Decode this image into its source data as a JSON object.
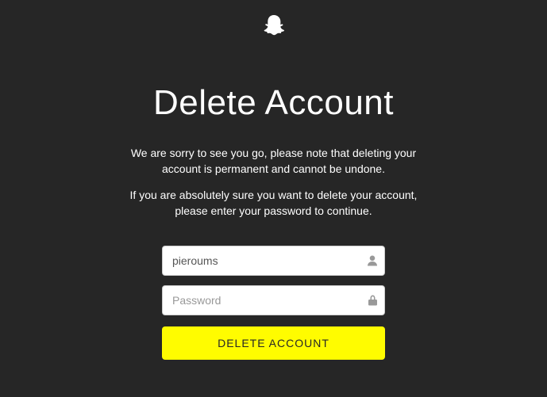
{
  "heading": "Delete Account",
  "description_line1": "We are sorry to see you go, please note that deleting your",
  "description_line2": "account is permanent and cannot be undone.",
  "confirm_line1": "If you are absolutely sure you want to delete your account,",
  "confirm_line2": "please enter your password to continue.",
  "form": {
    "username_value": "pieroums",
    "password_value": "",
    "password_placeholder": "Password",
    "submit_label": "DELETE ACCOUNT"
  },
  "colors": {
    "background": "#262626",
    "accent": "#fffc00",
    "text": "#ffffff"
  }
}
